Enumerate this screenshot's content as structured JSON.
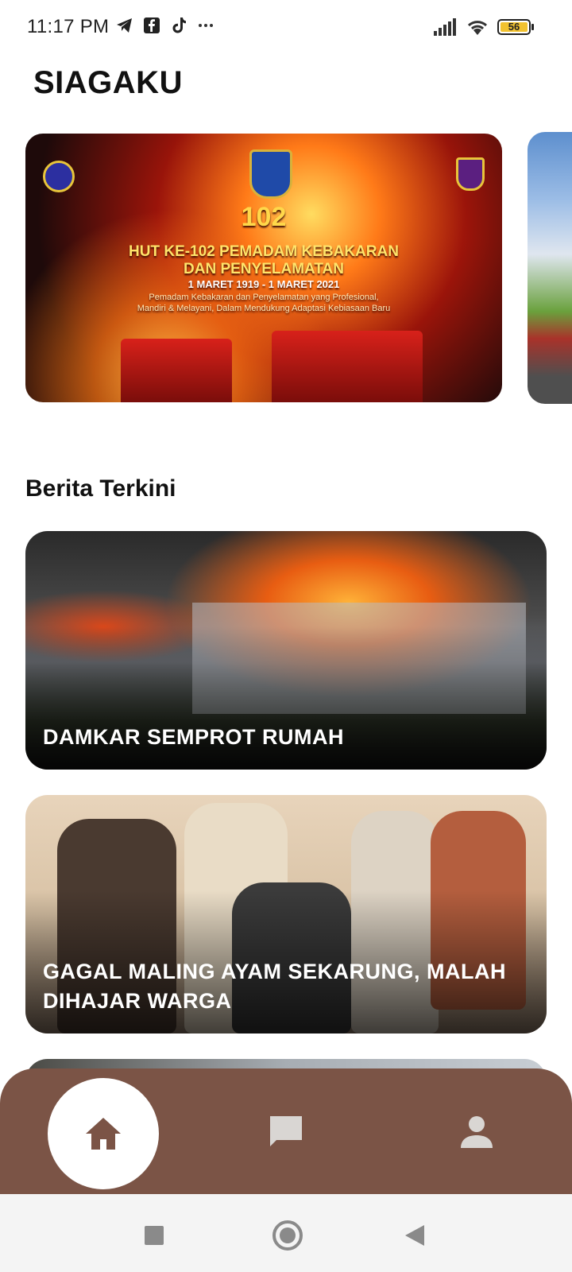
{
  "status_bar": {
    "time": "11:17 PM",
    "left_icons": [
      "telegram-icon",
      "facebook-icon",
      "tiktok-icon",
      "more-dots-icon"
    ],
    "right_icons": [
      "signal-icon",
      "wifi-icon",
      "battery-icon"
    ],
    "battery_level": "56"
  },
  "app": {
    "title": "SIAGAKU"
  },
  "banners": [
    {
      "line1": "HUT KE-102 PEMADAM KEBAKARAN",
      "line2": "DAN PENYELAMATAN",
      "line3": "1 MARET 1919 - 1 MARET 2021",
      "line4": "Pemadam Kebakaran dan Penyelamatan yang Profesional,",
      "line5": "Mandiri & Melayani, Dalam Mendukung Adaptasi Kebiasaan Baru",
      "badge": "102"
    }
  ],
  "section": {
    "title": "Berita Terkini"
  },
  "news": [
    {
      "title": "DAMKAR SEMPROT RUMAH"
    },
    {
      "title": "GAGAL MALING AYAM SEKARUNG, MALAH DIHAJAR WARGA"
    }
  ],
  "bottom_nav": {
    "items": [
      "home-icon",
      "chat-icon",
      "profile-icon"
    ],
    "active": "home",
    "colors": {
      "bar": "#7b5446",
      "active_bg": "#ffffff",
      "active_icon": "#7b5446",
      "inactive_icon": "#d9d6d3"
    }
  },
  "system_nav": {
    "buttons": [
      "recent-apps-button",
      "home-button",
      "back-button"
    ]
  }
}
